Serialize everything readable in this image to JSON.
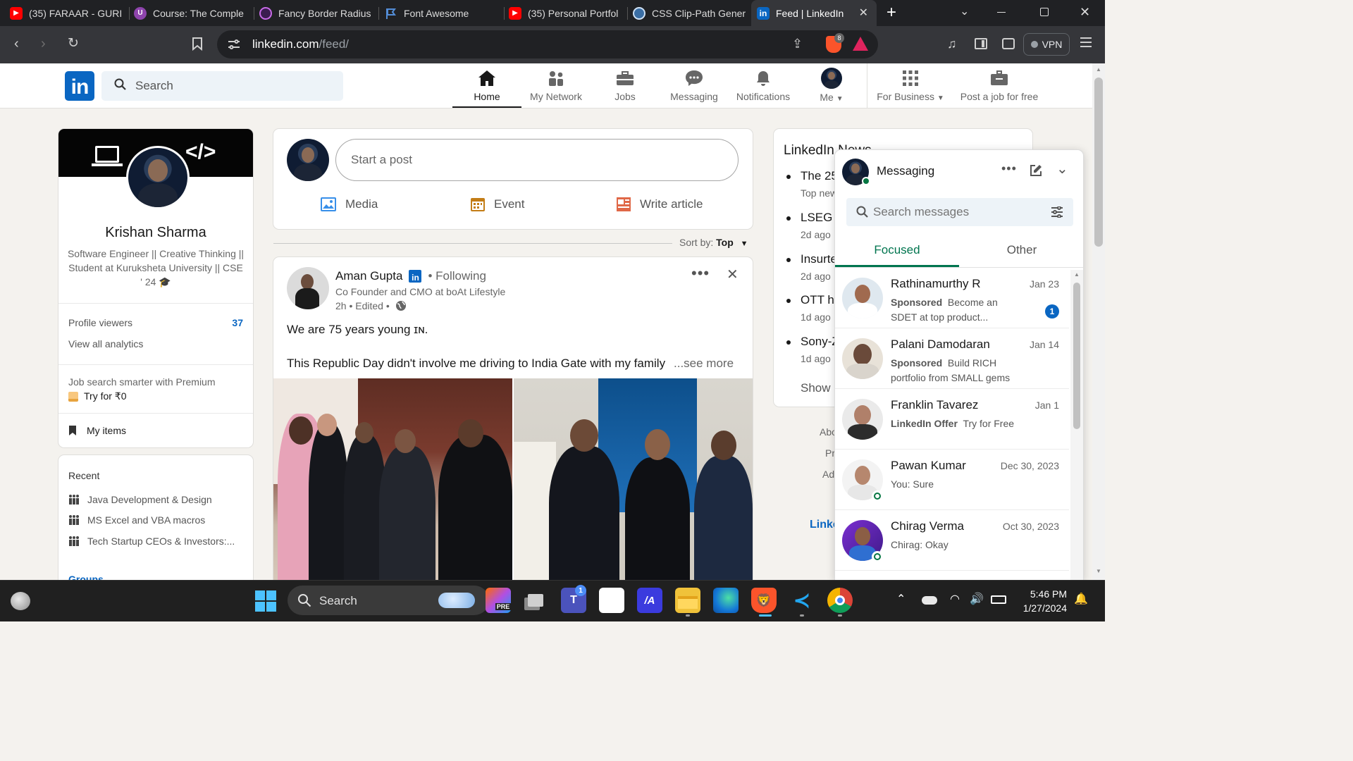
{
  "browser": {
    "tabs": [
      {
        "title": "(35) FARAAR - GURI",
        "icon": "youtube-icon",
        "color": "#ff0000"
      },
      {
        "title": "Course: The Comple",
        "icon": "course-icon",
        "color": "#8e44ad"
      },
      {
        "title": "Fancy Border Radius",
        "icon": "fancy-icon",
        "color": "#6c2c91"
      },
      {
        "title": "Font Awesome",
        "icon": "flag-icon",
        "color": "#538dd7"
      },
      {
        "title": "(35) Personal Portfol",
        "icon": "youtube-icon",
        "color": "#ff0000"
      },
      {
        "title": "CSS Clip-Path Gener",
        "icon": "clip-icon",
        "color": "#3a6ea5"
      },
      {
        "title": "Feed | LinkedIn",
        "icon": "linkedin-icon",
        "color": "#0a66c2"
      }
    ],
    "url_domain": "linkedin.com",
    "url_path": "/feed/",
    "vpn_label": "VPN",
    "brave_badge": "8"
  },
  "header": {
    "logo": "in",
    "search_placeholder": "Search",
    "nav": [
      {
        "label": "Home",
        "icon": "home-icon"
      },
      {
        "label": "My Network",
        "icon": "network-icon"
      },
      {
        "label": "Jobs",
        "icon": "briefcase-icon"
      },
      {
        "label": "Messaging",
        "icon": "messaging-icon"
      },
      {
        "label": "Notifications",
        "icon": "bell-icon"
      },
      {
        "label": "Me",
        "icon": "avatar-icon"
      },
      {
        "label": "For Business",
        "icon": "grid-icon"
      },
      {
        "label": "Post a job for free",
        "icon": "post-job-icon"
      }
    ]
  },
  "profile": {
    "name": "Krishan Sharma",
    "headline": "Software Engineer || Creative Thinking || Student at Kuruksheta University || CSE ' 24 🎓",
    "viewers_label": "Profile viewers",
    "viewers_count": "37",
    "analytics_label": "View all analytics",
    "premium_line1": "Job search smarter with Premium",
    "premium_line2": "Try for ₹0",
    "my_items": "My items"
  },
  "recent": {
    "title": "Recent",
    "items": [
      "Java Development & Design",
      "MS Excel and VBA macros",
      "Tech Startup CEOs & Investors:..."
    ],
    "groups_label": "Groups"
  },
  "composer": {
    "placeholder": "Start a post",
    "actions": [
      {
        "label": "Media",
        "icon": "image-icon",
        "color": "#378fe9"
      },
      {
        "label": "Event",
        "icon": "calendar-icon",
        "color": "#c37d16"
      },
      {
        "label": "Write article",
        "icon": "article-icon",
        "color": "#e06847"
      }
    ]
  },
  "sort": {
    "label": "Sort by:",
    "value": "Top"
  },
  "post": {
    "author": "Aman Gupta",
    "badge": "in",
    "following": "• Following",
    "subtitle": "Co Founder and CMO at boAt Lifestyle",
    "time": "2h • Edited •",
    "line1": "We are 75 years young ɪɴ.",
    "line2": "This Republic Day didn't involve me driving to India Gate with my family",
    "see_more": "...see more"
  },
  "news": {
    "title": "LinkedIn News",
    "items": [
      {
        "headline": "The 25",
        "meta": "Top new"
      },
      {
        "headline": "LSEG t",
        "meta": "2d ago"
      },
      {
        "headline": "Insurte",
        "meta": "2d ago"
      },
      {
        "headline": "OTT ha",
        "meta": "1d ago"
      },
      {
        "headline": "Sony-Z",
        "meta": "1d ago"
      }
    ],
    "show_more": "Show",
    "footer": [
      "Abo",
      "Pr",
      "Ad"
    ],
    "linkedin_footer": "Linke"
  },
  "messaging": {
    "title": "Messaging",
    "search_placeholder": "Search messages",
    "tabs": [
      "Focused",
      "Other"
    ],
    "conversations": [
      {
        "name": "Rathinamurthy R",
        "date": "Jan 23",
        "tag": "Sponsored",
        "preview": "Become an SDET at top product...",
        "unread": "1"
      },
      {
        "name": "Palani Damodaran",
        "date": "Jan 14",
        "tag": "Sponsored",
        "preview": "Build RICH portfolio from SMALL gems",
        "unread": ""
      },
      {
        "name": "Franklin Tavarez",
        "date": "Jan 1",
        "tag": "LinkedIn Offer",
        "preview": "Try for Free",
        "unread": ""
      },
      {
        "name": "Pawan Kumar",
        "date": "Dec 30, 2023",
        "tag": "",
        "preview": "You: Sure",
        "unread": ""
      },
      {
        "name": "Chirag Verma",
        "date": "Oct 30, 2023",
        "tag": "",
        "preview": "Chirag: Okay",
        "unread": ""
      }
    ]
  },
  "taskbar": {
    "search_label": "Search",
    "time": "5:46 PM",
    "date": "1/27/2024",
    "teams_badge": "1"
  },
  "colors": {
    "brand": "#0a66c2",
    "focus_green": "#01754f",
    "online": "#057642"
  }
}
